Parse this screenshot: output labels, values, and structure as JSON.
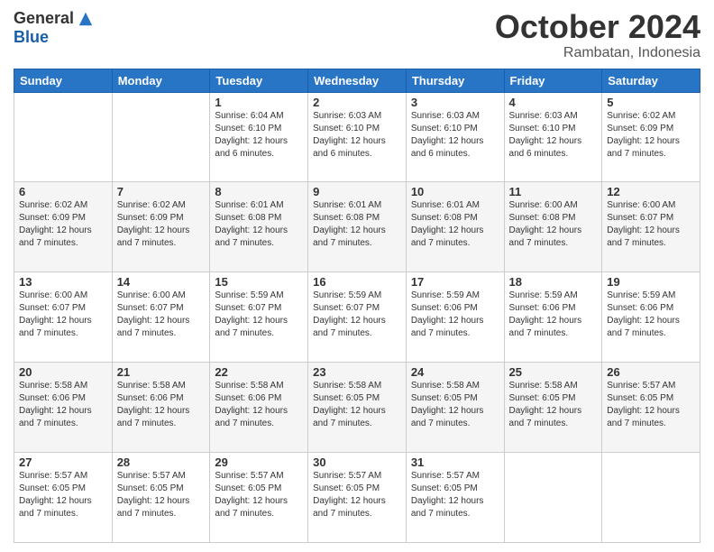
{
  "logo": {
    "general": "General",
    "blue": "Blue"
  },
  "header": {
    "month": "October 2024",
    "location": "Rambatan, Indonesia"
  },
  "weekdays": [
    "Sunday",
    "Monday",
    "Tuesday",
    "Wednesday",
    "Thursday",
    "Friday",
    "Saturday"
  ],
  "weeks": [
    [
      {
        "day": "",
        "info": ""
      },
      {
        "day": "",
        "info": ""
      },
      {
        "day": "1",
        "info": "Sunrise: 6:04 AM\nSunset: 6:10 PM\nDaylight: 12 hours and 6 minutes."
      },
      {
        "day": "2",
        "info": "Sunrise: 6:03 AM\nSunset: 6:10 PM\nDaylight: 12 hours and 6 minutes."
      },
      {
        "day": "3",
        "info": "Sunrise: 6:03 AM\nSunset: 6:10 PM\nDaylight: 12 hours and 6 minutes."
      },
      {
        "day": "4",
        "info": "Sunrise: 6:03 AM\nSunset: 6:10 PM\nDaylight: 12 hours and 6 minutes."
      },
      {
        "day": "5",
        "info": "Sunrise: 6:02 AM\nSunset: 6:09 PM\nDaylight: 12 hours and 7 minutes."
      }
    ],
    [
      {
        "day": "6",
        "info": "Sunrise: 6:02 AM\nSunset: 6:09 PM\nDaylight: 12 hours and 7 minutes."
      },
      {
        "day": "7",
        "info": "Sunrise: 6:02 AM\nSunset: 6:09 PM\nDaylight: 12 hours and 7 minutes."
      },
      {
        "day": "8",
        "info": "Sunrise: 6:01 AM\nSunset: 6:08 PM\nDaylight: 12 hours and 7 minutes."
      },
      {
        "day": "9",
        "info": "Sunrise: 6:01 AM\nSunset: 6:08 PM\nDaylight: 12 hours and 7 minutes."
      },
      {
        "day": "10",
        "info": "Sunrise: 6:01 AM\nSunset: 6:08 PM\nDaylight: 12 hours and 7 minutes."
      },
      {
        "day": "11",
        "info": "Sunrise: 6:00 AM\nSunset: 6:08 PM\nDaylight: 12 hours and 7 minutes."
      },
      {
        "day": "12",
        "info": "Sunrise: 6:00 AM\nSunset: 6:07 PM\nDaylight: 12 hours and 7 minutes."
      }
    ],
    [
      {
        "day": "13",
        "info": "Sunrise: 6:00 AM\nSunset: 6:07 PM\nDaylight: 12 hours and 7 minutes."
      },
      {
        "day": "14",
        "info": "Sunrise: 6:00 AM\nSunset: 6:07 PM\nDaylight: 12 hours and 7 minutes."
      },
      {
        "day": "15",
        "info": "Sunrise: 5:59 AM\nSunset: 6:07 PM\nDaylight: 12 hours and 7 minutes."
      },
      {
        "day": "16",
        "info": "Sunrise: 5:59 AM\nSunset: 6:07 PM\nDaylight: 12 hours and 7 minutes."
      },
      {
        "day": "17",
        "info": "Sunrise: 5:59 AM\nSunset: 6:06 PM\nDaylight: 12 hours and 7 minutes."
      },
      {
        "day": "18",
        "info": "Sunrise: 5:59 AM\nSunset: 6:06 PM\nDaylight: 12 hours and 7 minutes."
      },
      {
        "day": "19",
        "info": "Sunrise: 5:59 AM\nSunset: 6:06 PM\nDaylight: 12 hours and 7 minutes."
      }
    ],
    [
      {
        "day": "20",
        "info": "Sunrise: 5:58 AM\nSunset: 6:06 PM\nDaylight: 12 hours and 7 minutes."
      },
      {
        "day": "21",
        "info": "Sunrise: 5:58 AM\nSunset: 6:06 PM\nDaylight: 12 hours and 7 minutes."
      },
      {
        "day": "22",
        "info": "Sunrise: 5:58 AM\nSunset: 6:06 PM\nDaylight: 12 hours and 7 minutes."
      },
      {
        "day": "23",
        "info": "Sunrise: 5:58 AM\nSunset: 6:05 PM\nDaylight: 12 hours and 7 minutes."
      },
      {
        "day": "24",
        "info": "Sunrise: 5:58 AM\nSunset: 6:05 PM\nDaylight: 12 hours and 7 minutes."
      },
      {
        "day": "25",
        "info": "Sunrise: 5:58 AM\nSunset: 6:05 PM\nDaylight: 12 hours and 7 minutes."
      },
      {
        "day": "26",
        "info": "Sunrise: 5:57 AM\nSunset: 6:05 PM\nDaylight: 12 hours and 7 minutes."
      }
    ],
    [
      {
        "day": "27",
        "info": "Sunrise: 5:57 AM\nSunset: 6:05 PM\nDaylight: 12 hours and 7 minutes."
      },
      {
        "day": "28",
        "info": "Sunrise: 5:57 AM\nSunset: 6:05 PM\nDaylight: 12 hours and 7 minutes."
      },
      {
        "day": "29",
        "info": "Sunrise: 5:57 AM\nSunset: 6:05 PM\nDaylight: 12 hours and 7 minutes."
      },
      {
        "day": "30",
        "info": "Sunrise: 5:57 AM\nSunset: 6:05 PM\nDaylight: 12 hours and 7 minutes."
      },
      {
        "day": "31",
        "info": "Sunrise: 5:57 AM\nSunset: 6:05 PM\nDaylight: 12 hours and 7 minutes."
      },
      {
        "day": "",
        "info": ""
      },
      {
        "day": "",
        "info": ""
      }
    ]
  ]
}
